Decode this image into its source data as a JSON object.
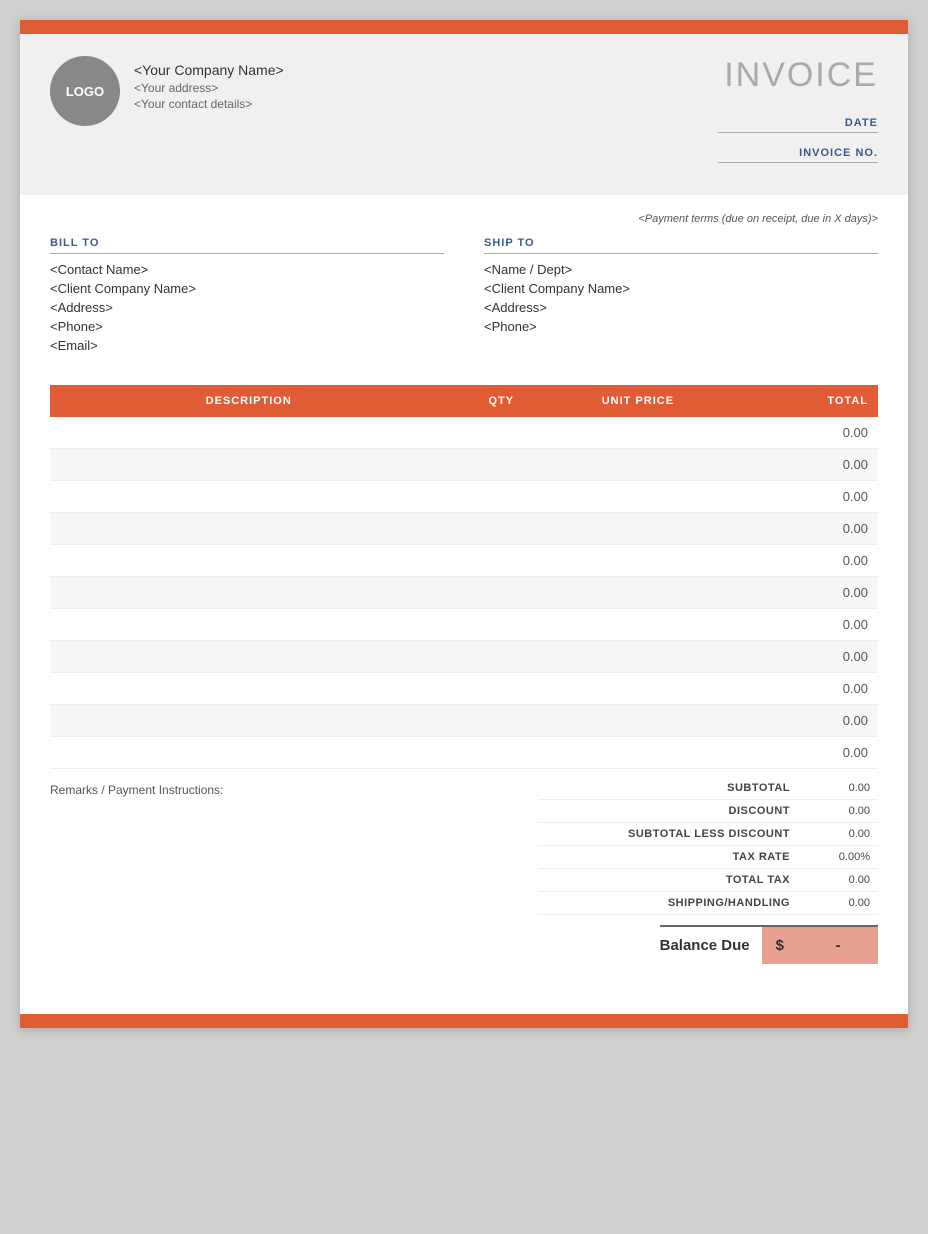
{
  "top_bar": {
    "color": "#e05c35"
  },
  "header": {
    "logo_text": "LOGO",
    "company_name": "<Your Company Name>",
    "company_address": "<Your address>",
    "company_contact": "<Your contact details>",
    "invoice_title": "INVOICE",
    "date_label": "DATE",
    "invoice_no_label": "INVOICE NO."
  },
  "payment_terms": "<Payment terms (due on receipt, due in X days)>",
  "bill_to": {
    "label": "BILL TO",
    "contact_name": "<Contact Name>",
    "company_name": "<Client Company Name>",
    "address": "<Address>",
    "phone": "<Phone>",
    "email": "<Email>"
  },
  "ship_to": {
    "label": "SHIP TO",
    "name_dept": "<Name / Dept>",
    "company_name": "<Client Company Name>",
    "address": "<Address>",
    "phone": "<Phone>"
  },
  "table": {
    "headers": {
      "description": "DESCRIPTION",
      "qty": "QTY",
      "unit_price": "UNIT PRICE",
      "total": "TOTAL"
    },
    "rows": [
      {
        "description": "",
        "qty": "",
        "unit_price": "",
        "total": "0.00"
      },
      {
        "description": "",
        "qty": "",
        "unit_price": "",
        "total": "0.00"
      },
      {
        "description": "",
        "qty": "",
        "unit_price": "",
        "total": "0.00"
      },
      {
        "description": "",
        "qty": "",
        "unit_price": "",
        "total": "0.00"
      },
      {
        "description": "",
        "qty": "",
        "unit_price": "",
        "total": "0.00"
      },
      {
        "description": "",
        "qty": "",
        "unit_price": "",
        "total": "0.00"
      },
      {
        "description": "",
        "qty": "",
        "unit_price": "",
        "total": "0.00"
      },
      {
        "description": "",
        "qty": "",
        "unit_price": "",
        "total": "0.00"
      },
      {
        "description": "",
        "qty": "",
        "unit_price": "",
        "total": "0.00"
      },
      {
        "description": "",
        "qty": "",
        "unit_price": "",
        "total": "0.00"
      },
      {
        "description": "",
        "qty": "",
        "unit_price": "",
        "total": "0.00"
      }
    ]
  },
  "remarks_label": "Remarks / Payment Instructions:",
  "totals": {
    "subtotal_label": "SUBTOTAL",
    "subtotal_value": "0.00",
    "discount_label": "DISCOUNT",
    "discount_value": "0.00",
    "subtotal_less_discount_label": "SUBTOTAL LESS DISCOUNT",
    "subtotal_less_discount_value": "0.00",
    "tax_rate_label": "TAX RATE",
    "tax_rate_value": "0.00%",
    "total_tax_label": "TOTAL TAX",
    "total_tax_value": "0.00",
    "shipping_label": "SHIPPING/HANDLING",
    "shipping_value": "0.00"
  },
  "balance_due": {
    "label": "Balance Due",
    "dollar_sign": "$",
    "amount": "-"
  }
}
